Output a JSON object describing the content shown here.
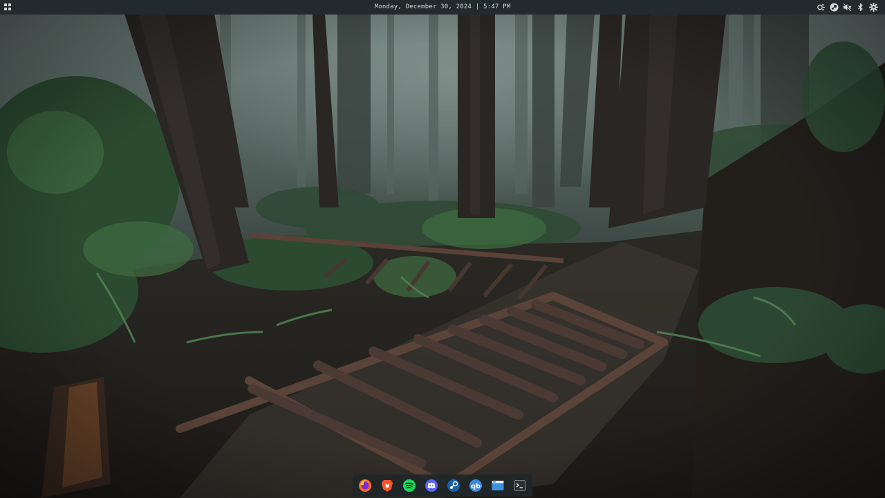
{
  "topbar": {
    "clock_text": "Monday, December 30, 2024 | 5:47 PM",
    "background": "#232a2e",
    "text_color": "#d3dad6",
    "workspaces_icon": "grid-icon",
    "tray": [
      {
        "icon": "weather-icon"
      },
      {
        "icon": "steam-tray-icon"
      },
      {
        "icon": "volume-muted-icon"
      },
      {
        "icon": "bluetooth-icon"
      },
      {
        "icon": "settings-gear-icon"
      }
    ]
  },
  "wallpaper": {
    "description_colors": {
      "forest_dark": "#1d2422",
      "fog": "#7d8c88",
      "stairs": "#4a3a33"
    }
  },
  "dock": {
    "items": [
      {
        "app": "firefox",
        "icon": "firefox-icon",
        "color": "#ff6a13"
      },
      {
        "app": "brave",
        "icon": "brave-icon",
        "color": "#fb542b"
      },
      {
        "app": "spotify",
        "icon": "spotify-icon",
        "color": "#1ed760"
      },
      {
        "app": "discord",
        "icon": "discord-icon",
        "color": "#5865f2"
      },
      {
        "app": "steam",
        "icon": "steam-icon",
        "color": "#1b5fa8"
      },
      {
        "app": "qbittorrent",
        "icon": "qbittorrent-icon",
        "color": "#3a87d8"
      },
      {
        "app": "files",
        "icon": "files-icon",
        "color": "#3d8fe0"
      },
      {
        "app": "terminal",
        "icon": "terminal-icon",
        "color": "#2b2f31"
      }
    ]
  }
}
